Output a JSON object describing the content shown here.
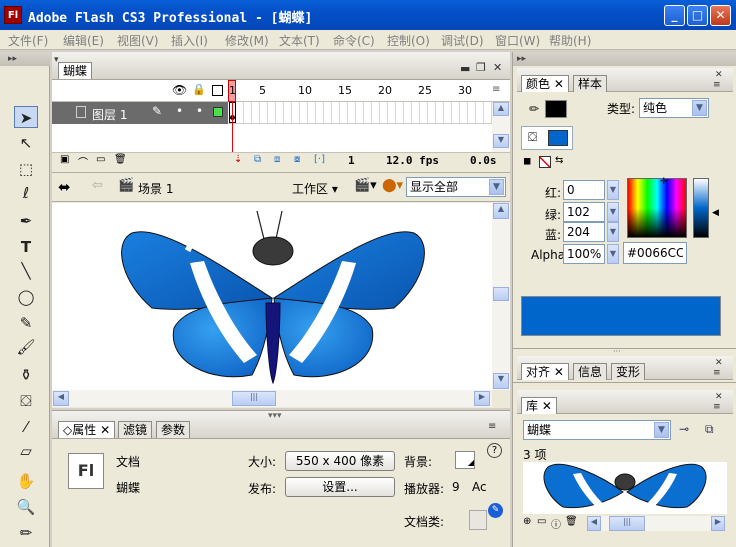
{
  "window": {
    "title": "Adobe Flash CS3 Professional - [蝴蝶]",
    "logo": "Fl",
    "min_label": "_",
    "max_label": "□",
    "close_label": "✕"
  },
  "menu": [
    "文件(F)",
    "编辑(E)",
    "视图(V)",
    "插入(I)",
    "修改(M)",
    "文本(T)",
    "命令(C)",
    "控制(O)",
    "调试(D)",
    "窗口(W)",
    "帮助(H)"
  ],
  "document_tab": "蝴蝶",
  "timeline": {
    "frame_numbers": [
      "1",
      "5",
      "10",
      "15",
      "20",
      "25",
      "30"
    ],
    "layer_name": "图层 1",
    "current_frame": "1",
    "fps": "12.0 fps",
    "time": "0.0s"
  },
  "edit_bar": {
    "scene": "场景 1",
    "workspace": "工作区",
    "zoom": "显示全部"
  },
  "properties": {
    "tabs": [
      "属性",
      "滤镜",
      "参数"
    ],
    "doc_label": "文档",
    "doc_name": "蝴蝶",
    "size_label": "大小:",
    "size_value": "550 x 400 像素",
    "publish_label": "发布:",
    "settings_button": "设置...",
    "background_label": "背景:",
    "player_label": "播放器:",
    "player_value": "9",
    "as_label": "Ac",
    "doc_class_label": "文档类:",
    "help": "?",
    "logo": "Fl"
  },
  "color_panel": {
    "tabs": [
      "颜色",
      "样本"
    ],
    "type_label": "类型:",
    "type_value": "纯色",
    "red_label": "红:",
    "red": "0",
    "green_label": "绿:",
    "green": "102",
    "blue_label": "蓝:",
    "blue": "204",
    "alpha_label": "Alpha:",
    "alpha": "100%",
    "hex": "#0066CC",
    "fill_color": "#0066cc",
    "stroke_color": "#000000"
  },
  "align_panel": {
    "tabs": [
      "对齐",
      "信息",
      "变形"
    ]
  },
  "library": {
    "tab": "库",
    "document": "蝴蝶",
    "count": "3 项"
  },
  "colors": {
    "wing_blue": "#0a6fd0",
    "body": "#1a1a7a"
  }
}
